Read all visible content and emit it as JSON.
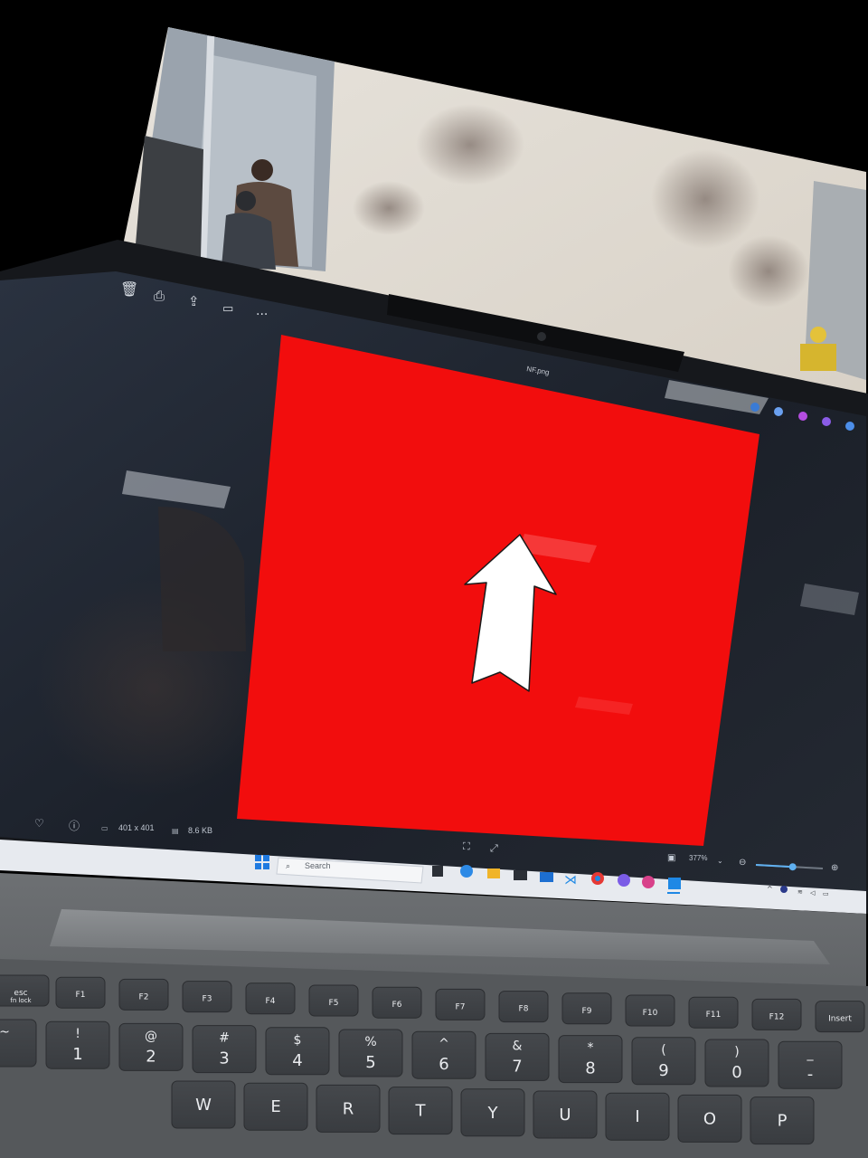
{
  "window_title": "NF.png",
  "info_bar": {
    "dimensions": "401 x 401",
    "file_size": "8.6 KB"
  },
  "zoom": {
    "level_label": "377%",
    "slider_position": 0.55
  },
  "taskbar": {
    "search_placeholder": "Search"
  },
  "keyboard": {
    "fn_row": [
      {
        "name": "esc",
        "sub": "fn lock"
      },
      {
        "name": "F1",
        "sub": ""
      },
      {
        "name": "F2",
        "sub": ""
      },
      {
        "name": "F3",
        "sub": ""
      },
      {
        "name": "F4",
        "sub": ""
      },
      {
        "name": "F5",
        "sub": ""
      },
      {
        "name": "F6",
        "sub": ""
      },
      {
        "name": "F7",
        "sub": ""
      },
      {
        "name": "F8",
        "sub": ""
      },
      {
        "name": "F9",
        "sub": ""
      },
      {
        "name": "F10",
        "sub": ""
      },
      {
        "name": "F11",
        "sub": ""
      },
      {
        "name": "F12",
        "sub": ""
      },
      {
        "name": "Insert",
        "sub": ""
      }
    ],
    "number_row": [
      {
        "top": "~",
        "bottom": ""
      },
      {
        "top": "!",
        "bottom": "1"
      },
      {
        "top": "@",
        "bottom": "2"
      },
      {
        "top": "#",
        "bottom": "3"
      },
      {
        "top": "$",
        "bottom": "4"
      },
      {
        "top": "%",
        "bottom": "5"
      },
      {
        "top": "^",
        "bottom": "6"
      },
      {
        "top": "&",
        "bottom": "7"
      },
      {
        "top": "*",
        "bottom": "8"
      },
      {
        "top": "(",
        "bottom": "9"
      },
      {
        "top": ")",
        "bottom": "0"
      },
      {
        "top": "_",
        "bottom": "-"
      }
    ],
    "letter_row": [
      "W",
      "E",
      "R",
      "T",
      "Y",
      "U",
      "I",
      "O",
      "P"
    ]
  },
  "colors": {
    "image_red": "#f20d0d",
    "arrow_fill": "#ffffff",
    "screen_bg": "#1e2430",
    "keyboard_body": "#5e6164"
  }
}
